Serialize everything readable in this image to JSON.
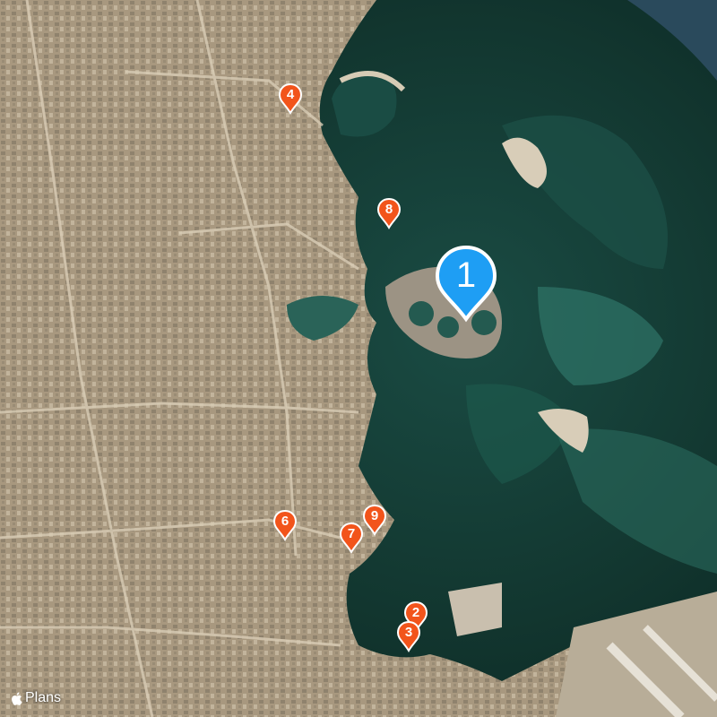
{
  "map": {
    "kind": "satellite",
    "colors": {
      "sea_deep": "#0d2f2a",
      "sea_shallow": "#1f5d52",
      "land": "#b5a48a",
      "sand": "#d8cdb8",
      "pin_orange": "#f2541b",
      "pin_blue": "#1e9ef4"
    }
  },
  "pins": [
    {
      "label": "1",
      "style": "selected",
      "icon": "map-pin-icon"
    },
    {
      "label": "2",
      "style": "default",
      "icon": "map-pin-icon"
    },
    {
      "label": "3",
      "style": "default",
      "icon": "map-pin-icon"
    },
    {
      "label": "4",
      "style": "default",
      "icon": "map-pin-icon"
    },
    {
      "label": "6",
      "style": "default",
      "icon": "map-pin-icon"
    },
    {
      "label": "7",
      "style": "default",
      "icon": "map-pin-icon"
    },
    {
      "label": "8",
      "style": "default",
      "icon": "map-pin-icon"
    },
    {
      "label": "9",
      "style": "default",
      "icon": "map-pin-icon"
    }
  ],
  "attribution": {
    "icon": "apple-logo-icon",
    "text": "Plans"
  }
}
